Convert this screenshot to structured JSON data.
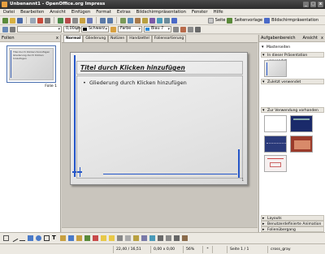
{
  "window": {
    "title": "Unbenannt1 - OpenOffice.org Impress"
  },
  "menu": [
    "Datei",
    "Bearbeiten",
    "Ansicht",
    "Einfügen",
    "Format",
    "Extras",
    "Bildschirmpräsentation",
    "Fenster",
    "Hilfe"
  ],
  "toolbar1": {
    "seite": "Seite",
    "seitenvorlage": "Seitenvorlage",
    "bildschirmpraesentation": "Bildschirmpräsentation"
  },
  "toolbar2": {
    "line_width": "0,00cm",
    "line_color": "Schwarz",
    "fill_type": "Farbe",
    "fill_color": "Blau 7"
  },
  "slides_pane": {
    "title": "Folien",
    "close": "x",
    "slide_label": "Folie 1",
    "thumb_title": "Titel durch Klicken hinzufügen",
    "thumb_text": "Gliederung durch Klicken hinzufügen"
  },
  "view_tabs": [
    "Normal",
    "Gliederung",
    "Notizen",
    "Handzettel",
    "Foliensortierung"
  ],
  "slide": {
    "title": "Titel durch Klicken hinzufügen",
    "bullet": "Gliederung durch Klicken hinzufügen",
    "number": "1"
  },
  "task_pane": {
    "title": "Aufgabenbereich",
    "view_label": "Ansicht",
    "close": "x",
    "sections": {
      "masterseiten": "Masterseiten",
      "in_praesentation": "In dieser Präsentation verwendet",
      "zuletzt": "Zuletzt verwendet",
      "vorhanden": "Zur Verwendung vorhanden",
      "layouts": "Layouts",
      "animation": "Benutzerdefinierte Animation",
      "folienuebergang": "Folienübergang"
    }
  },
  "status": {
    "position": "22,40 / 16,51",
    "size": "0,00 x 0,00",
    "zoom": "56%",
    "modified": "*",
    "slide": "Seite 1 / 1",
    "master": "cross_gray"
  },
  "colors": {
    "accent_blue": "#2556c8",
    "titlebar": "#3a3a3a",
    "chrome": "#ece9e2"
  }
}
